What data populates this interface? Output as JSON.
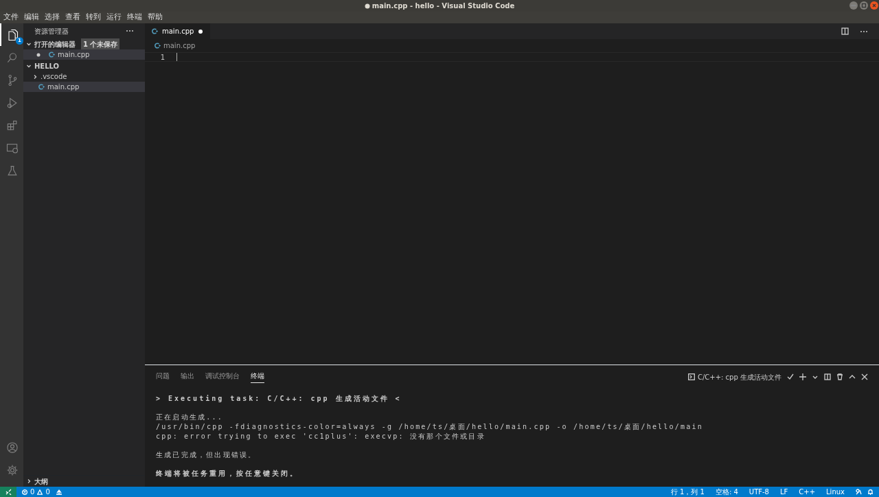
{
  "window": {
    "title": "main.cpp - hello - Visual Studio Code",
    "unsaved": true
  },
  "menu": [
    "文件",
    "编辑",
    "选择",
    "查看",
    "转到",
    "运行",
    "终端",
    "帮助"
  ],
  "activity_bar": {
    "top": [
      {
        "kind": "explorer",
        "selected": true,
        "badge": "1"
      },
      {
        "kind": "search",
        "selected": false
      },
      {
        "kind": "source-control",
        "selected": false
      },
      {
        "kind": "run",
        "selected": false
      },
      {
        "kind": "extensions",
        "selected": false
      },
      {
        "kind": "remote",
        "selected": false
      },
      {
        "kind": "testing",
        "selected": false
      }
    ],
    "bottom": [
      {
        "kind": "account",
        "selected": false
      },
      {
        "kind": "settings",
        "selected": false
      }
    ]
  },
  "sidebar": {
    "title": "资源管理器",
    "sections": [
      {
        "title": "打开的编辑器",
        "expanded": true,
        "badge": "1 个未保存",
        "items": [
          {
            "label": "main.cpp",
            "kind": "file",
            "dirty": true,
            "selected": true
          }
        ]
      },
      {
        "title": "HELLO",
        "expanded": true,
        "items": [
          {
            "label": ".vscode",
            "kind": "folder",
            "expanded": false,
            "selected": false
          },
          {
            "label": "main.cpp",
            "kind": "file",
            "selected": true
          }
        ]
      }
    ],
    "footer": {
      "title": "大纲",
      "expanded": false
    }
  },
  "editor": {
    "tabs": [
      {
        "label": "main.cpp",
        "selected": true,
        "dirty": true
      }
    ],
    "breadcrumb": "main.cpp",
    "lines": [
      {
        "number": "1"
      }
    ]
  },
  "panel": {
    "tabs": [
      {
        "label": "问题",
        "selected": false
      },
      {
        "label": "输出",
        "selected": false
      },
      {
        "label": "调试控制台",
        "selected": false
      },
      {
        "label": "终端",
        "selected": true
      }
    ],
    "task": "C/C++: cpp 生成活动文件",
    "terminal": [
      {
        "lines": [
          {
            "text": "> Executing task: C/C++: cpp 生成活动文件 <",
            "bold": true
          }
        ]
      },
      {
        "lines": [
          {
            "text": "正在启动生成...",
            "bold": false
          },
          {
            "text": "/usr/bin/cpp -fdiagnostics-color=always -g /home/ts/桌面/hello/main.cpp -o /home/ts/桌面/hello/main",
            "bold": false
          },
          {
            "text": "cpp: error trying to exec 'cc1plus': execvp: 没有那个文件或目录",
            "bold": false
          }
        ]
      },
      {
        "lines": [
          {
            "text": "生成已完成，但出现错误。",
            "bold": false
          }
        ]
      },
      {
        "lines": [
          {
            "text": "终端将被任务重用，按任意键关闭。",
            "bold": true
          }
        ]
      }
    ]
  },
  "status_bar": {
    "errors": "0",
    "warnings": "0",
    "items": [
      "行 1，列 1",
      "空格: 4",
      "UTF-8",
      "LF",
      "C++",
      "Linux"
    ]
  }
}
